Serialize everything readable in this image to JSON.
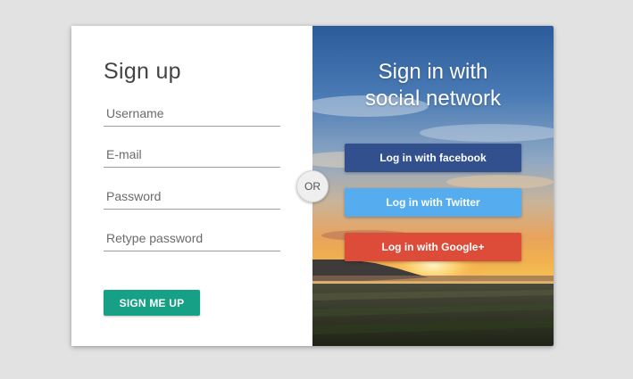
{
  "signup": {
    "title": "Sign up",
    "fields": [
      {
        "placeholder": "Username",
        "value": ""
      },
      {
        "placeholder": "E-mail",
        "value": ""
      },
      {
        "placeholder": "Password",
        "value": ""
      },
      {
        "placeholder": "Retype password",
        "value": ""
      }
    ],
    "submit_label": "SIGN ME UP"
  },
  "divider": {
    "label": "OR"
  },
  "social": {
    "title_line1": "Sign in with",
    "title_line2": "social network",
    "buttons": [
      {
        "label": "Log in with facebook",
        "color": "#32508e"
      },
      {
        "label": "Log in with Twitter",
        "color": "#55acee"
      },
      {
        "label": "Log in with Google+",
        "color": "#dd4b39"
      }
    ]
  },
  "colors": {
    "accent": "#16a085",
    "background": "#e2e2e2"
  }
}
